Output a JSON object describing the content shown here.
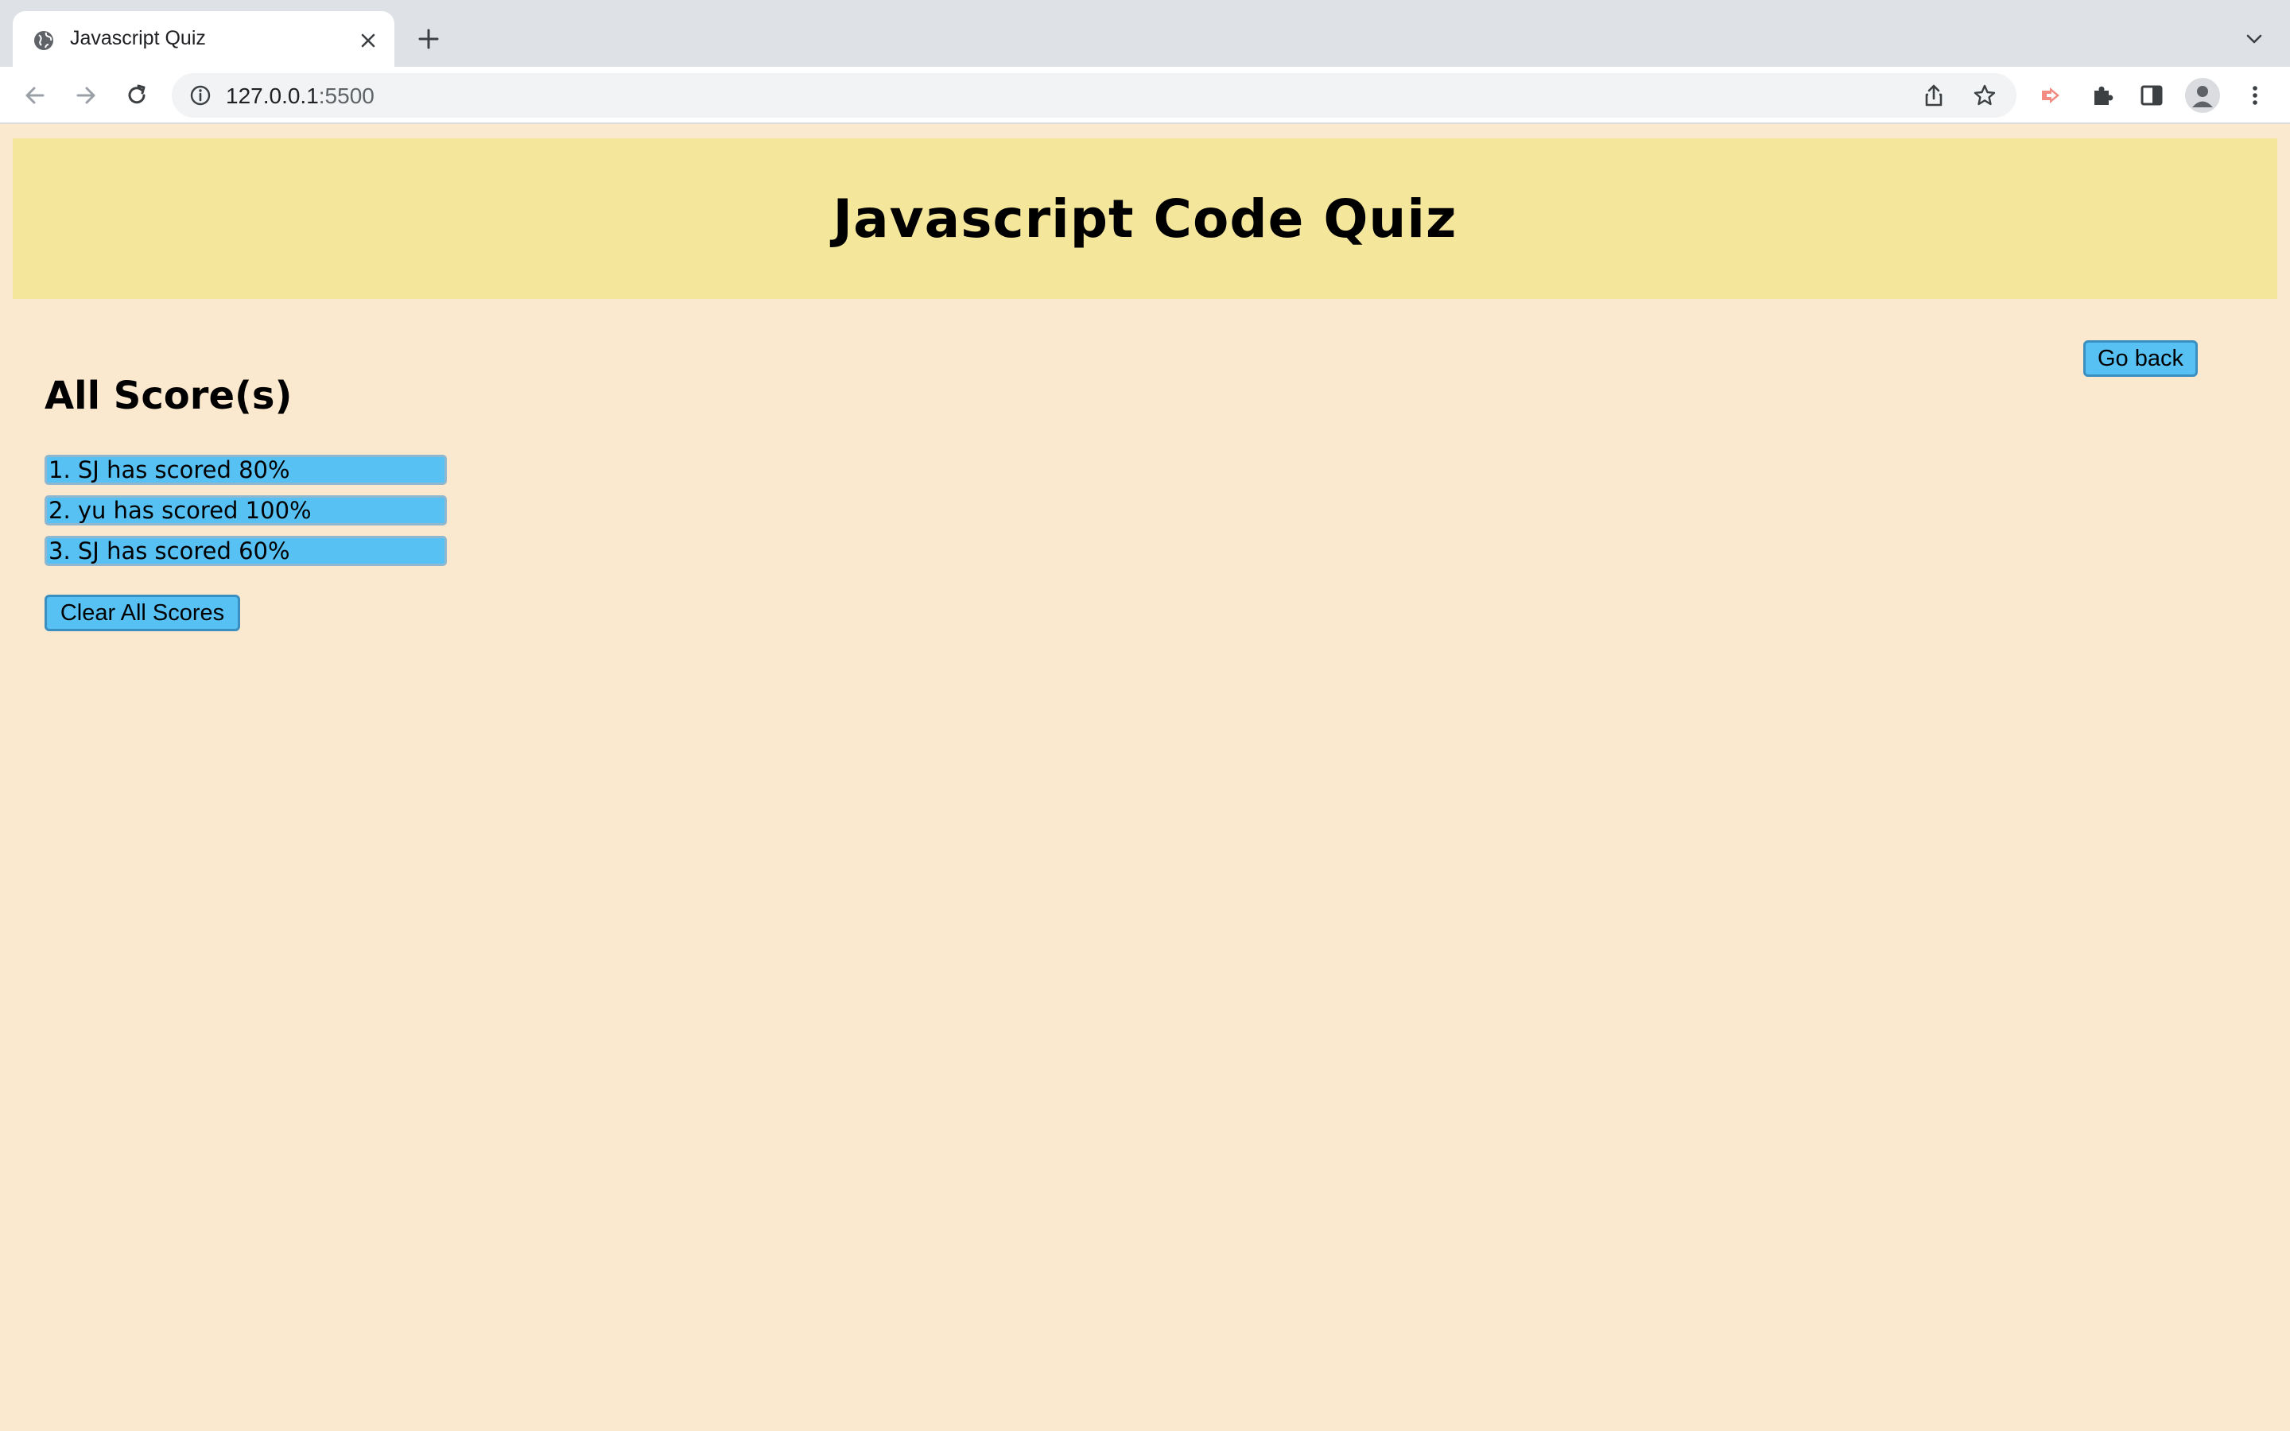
{
  "browser": {
    "tab_title": "Javascript Quiz",
    "url_host": "127.0.0.1",
    "url_port": ":5500",
    "icons": {
      "favicon": "globe-icon",
      "close": "close-icon",
      "new_tab": "plus-icon",
      "tab_list": "chevron-down-icon",
      "back": "back-arrow-icon",
      "forward": "forward-arrow-icon",
      "reload": "reload-icon",
      "site_info": "info-icon",
      "share": "share-icon",
      "bookmark": "star-icon",
      "extension_red": "extension-icon",
      "extensions": "puzzle-icon",
      "side_panel": "side-panel-icon",
      "profile": "profile-icon",
      "menu": "kebab-menu-icon"
    }
  },
  "header": {
    "title": "Javascript Code Quiz"
  },
  "main": {
    "go_back_label": "Go back",
    "heading": "All Score(s)",
    "scores": [
      "1. SJ has scored 80%",
      "2. yu has scored 100%",
      "3. SJ has scored 60%"
    ],
    "clear_label": "Clear All Scores"
  },
  "colors": {
    "page_background": "#fbe9cf",
    "banner_background": "#f4e79c",
    "button_blue": "#57c1f4"
  }
}
